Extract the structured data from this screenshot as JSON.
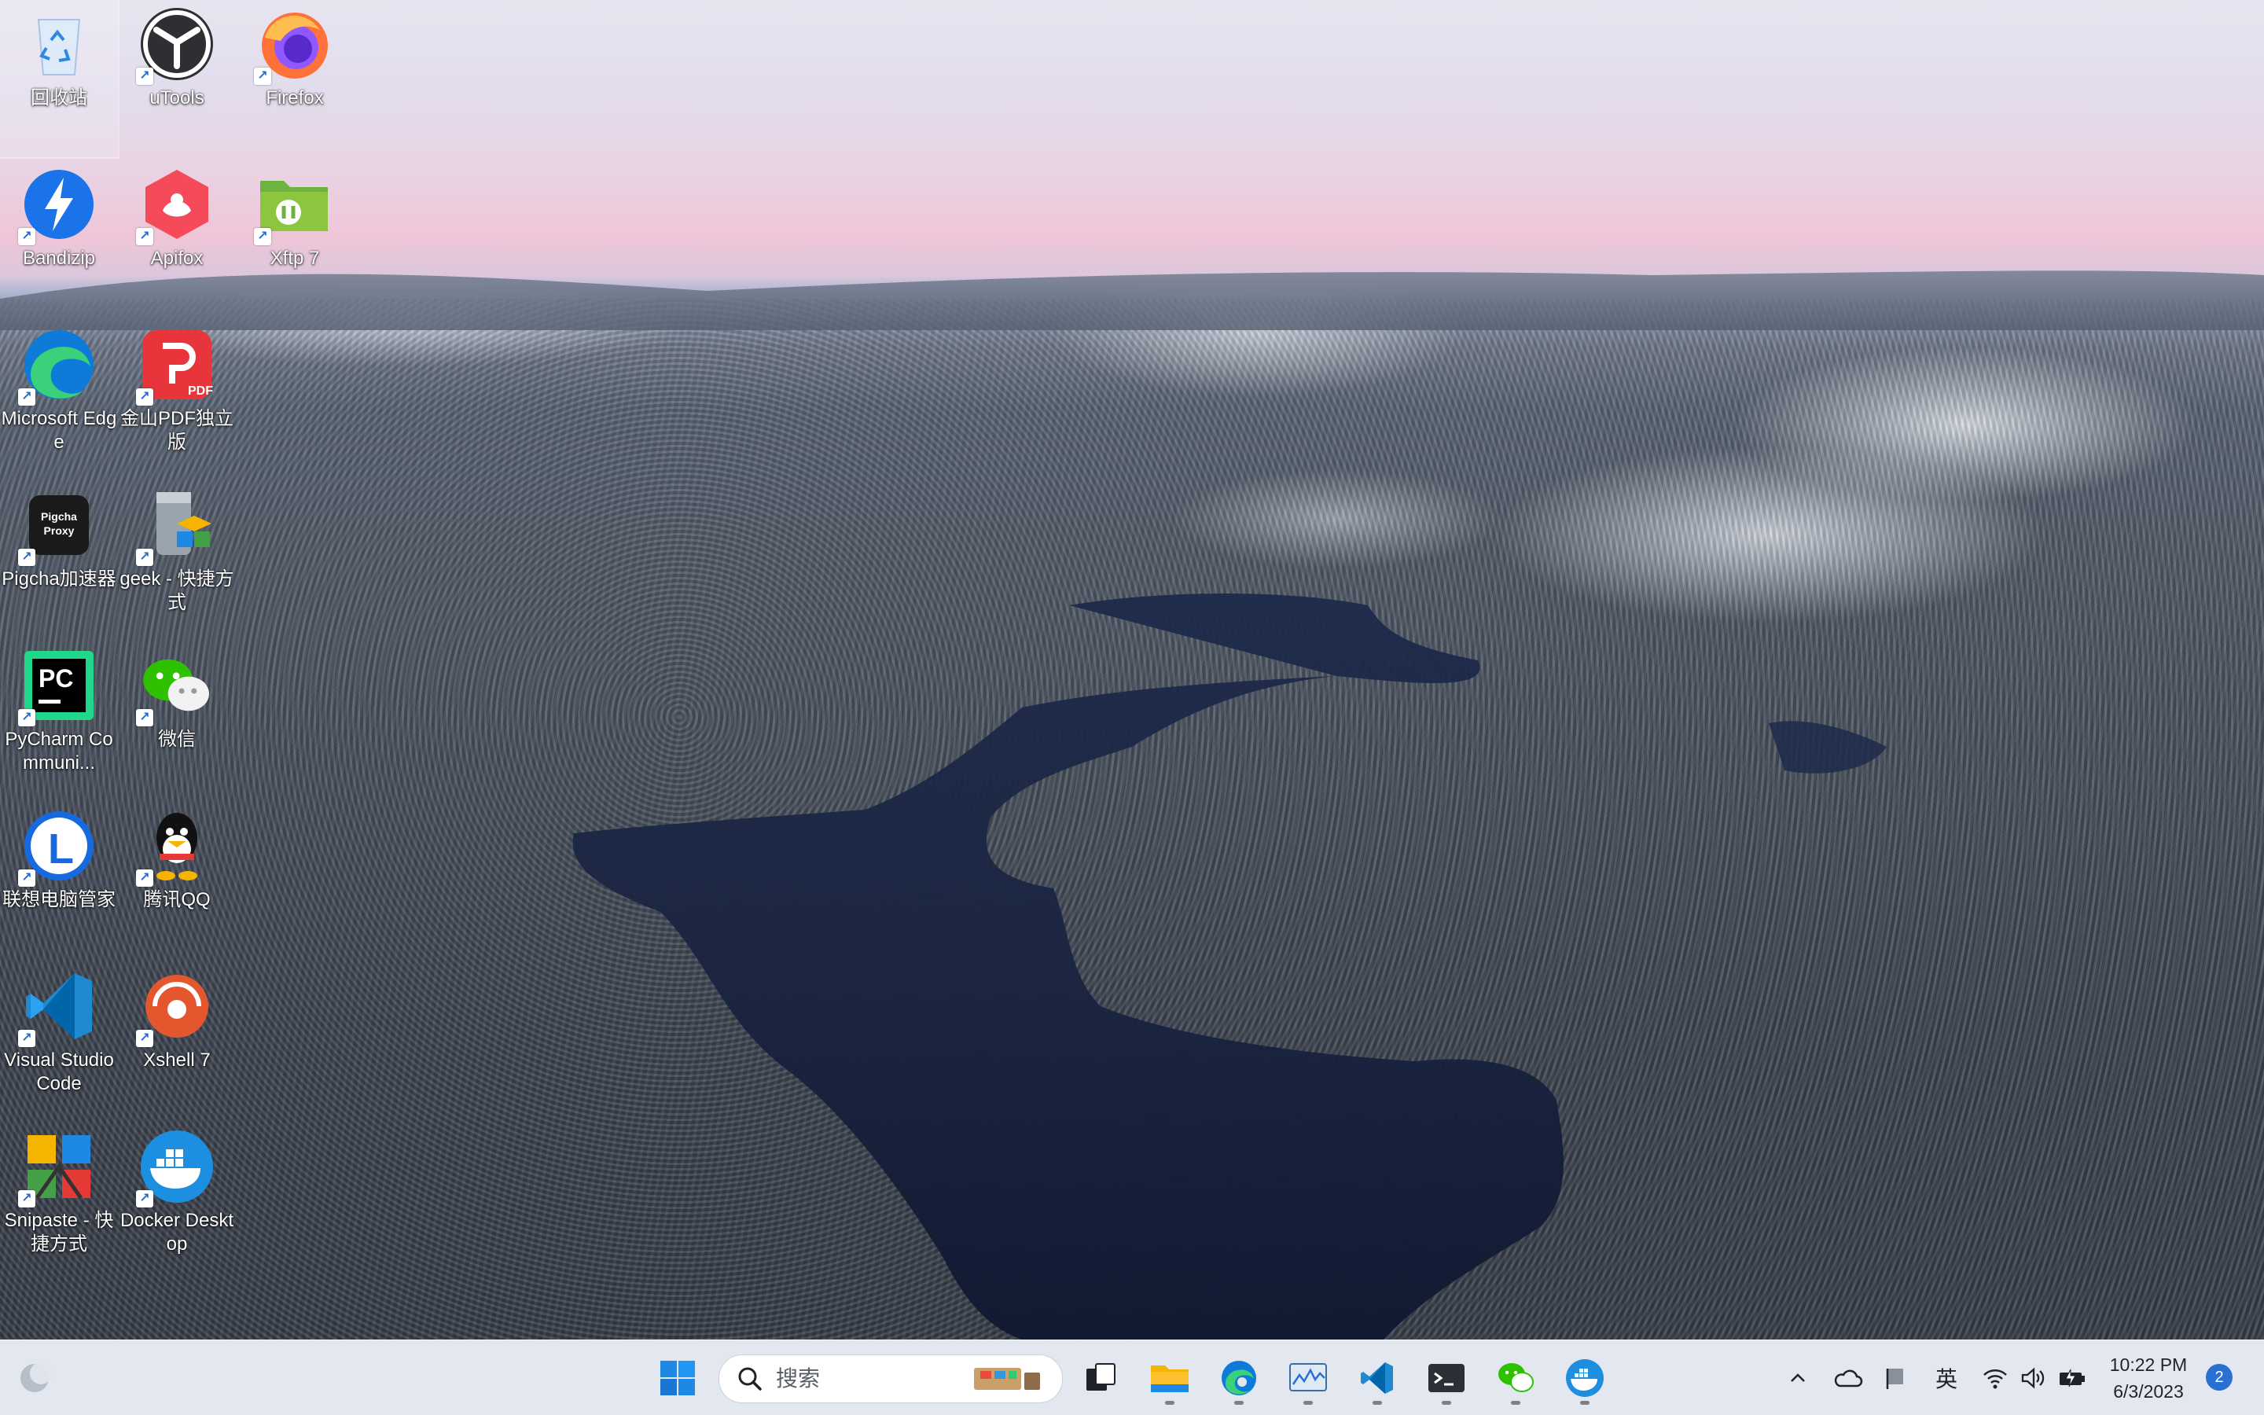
{
  "desktop_icons": [
    {
      "label": "回收站",
      "icon": "recycle-bin-icon"
    },
    {
      "label": "uTools",
      "icon": "utools-icon"
    },
    {
      "label": "Firefox",
      "icon": "firefox-icon"
    },
    {
      "label": "Bandizip",
      "icon": "bandizip-icon"
    },
    {
      "label": "Apifox",
      "icon": "apifox-icon"
    },
    {
      "label": "Xftp 7",
      "icon": "xftp-icon"
    },
    {
      "label": "Microsoft Edge",
      "icon": "edge-icon"
    },
    {
      "label": "金山PDF独立版",
      "icon": "kingsoft-pdf-icon",
      "glyph": "PDF"
    },
    {
      "label": "Pigcha加速器",
      "icon": "pigcha-icon",
      "glyph": "Pigcha Proxy"
    },
    {
      "label": "geek - 快捷方式",
      "icon": "geek-icon"
    },
    {
      "label": "PyCharm Communi...",
      "icon": "pycharm-icon",
      "glyph": "PC"
    },
    {
      "label": "微信",
      "icon": "wechat-icon"
    },
    {
      "label": "联想电脑管家",
      "icon": "lenovo-manager-icon",
      "glyph": "L"
    },
    {
      "label": "腾讯QQ",
      "icon": "qq-icon"
    },
    {
      "label": "Visual Studio Code",
      "icon": "vscode-icon"
    },
    {
      "label": "Xshell 7",
      "icon": "xshell-icon"
    },
    {
      "label": "Snipaste - 快捷方式",
      "icon": "snipaste-icon"
    },
    {
      "label": "Docker Desktop",
      "icon": "docker-icon"
    }
  ],
  "taskbar": {
    "search_placeholder": "搜索",
    "pinned": [
      {
        "name": "start-button",
        "icon": "windows-icon"
      },
      {
        "name": "task-view-button",
        "icon": "task-view-icon"
      },
      {
        "name": "file-explorer-button",
        "icon": "folder-icon",
        "running": true
      },
      {
        "name": "edge-button",
        "icon": "edge-icon",
        "running": true
      },
      {
        "name": "monitor-button",
        "icon": "resource-monitor-icon",
        "running": true
      },
      {
        "name": "vscode-button",
        "icon": "vscode-icon",
        "running": true
      },
      {
        "name": "terminal-button",
        "icon": "terminal-icon",
        "running": true
      },
      {
        "name": "wechat-button",
        "icon": "wechat-icon",
        "running": true
      },
      {
        "name": "docker-button",
        "icon": "docker-icon",
        "running": true
      }
    ],
    "tray": {
      "ime": "英",
      "time": "10:22 PM",
      "date": "6/3/2023",
      "notifications": "2"
    }
  },
  "colors": {
    "taskbar_bg": "#e2e6ee",
    "accent": "#2a6fd3"
  }
}
